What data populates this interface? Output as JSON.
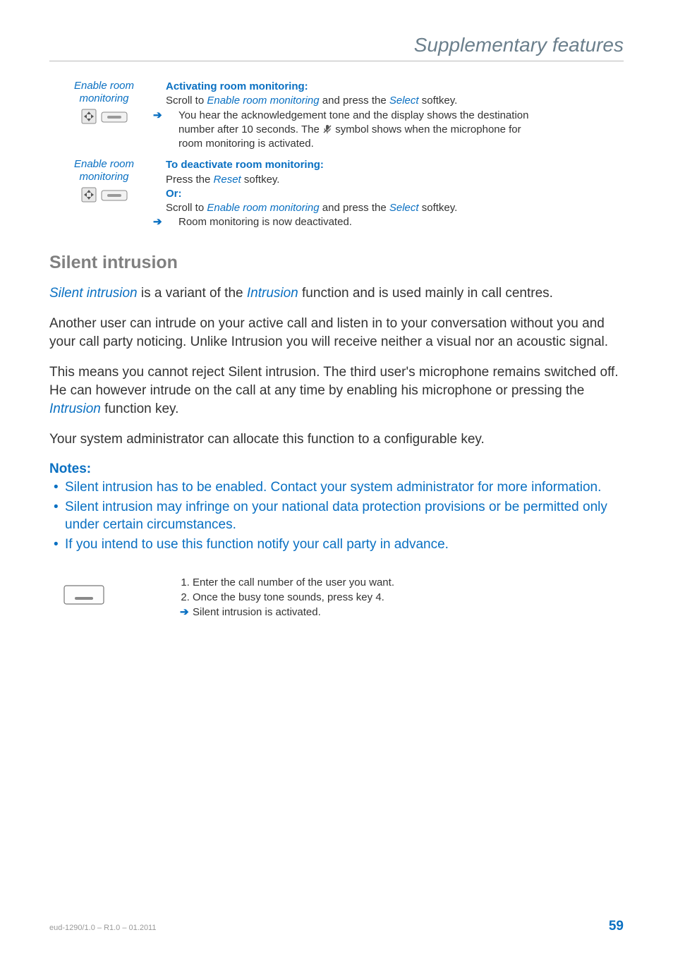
{
  "header": {
    "title": "Supplementary features"
  },
  "block1": {
    "left_label": "Enable room monitoring",
    "heading": "Activating room monitoring:",
    "line1_pre": "Scroll to ",
    "line1_term": "Enable room monitoring",
    "line1_mid": " and press the ",
    "line1_term2": "Select",
    "line1_post": " softkey.",
    "arrow_line_a": "You hear the acknowledgement tone and the display shows the destination",
    "arrow_line_b_pre": "number after 10 seconds. The ",
    "arrow_line_b_post": " symbol shows when the microphone for",
    "arrow_line_c": "room monitoring is activated."
  },
  "block2": {
    "left_label": "Enable room monitoring",
    "heading": "To deactivate room monitoring:",
    "line1_pre": "Press the ",
    "line1_term": "Reset",
    "line1_post": " softkey.",
    "or": "Or:",
    "line2_pre": "Scroll to ",
    "line2_term": "Enable room monitoring",
    "line2_mid": " and press the ",
    "line2_term2": "Select",
    "line2_post": " softkey.",
    "arrow_line": "Room monitoring is now deactivated."
  },
  "section": {
    "title": "Silent intrusion",
    "p1_term1": "Silent intrusion",
    "p1_mid": " is a variant of the ",
    "p1_term2": "Intrusion",
    "p1_post": " function and is used mainly in call centres.",
    "p2": "Another user can intrude on your active call and listen in to your conversation without you and your call party noticing. Unlike Intrusion you will receive neither a visual nor an acoustic signal.",
    "p3_pre": "This means you cannot reject Silent intrusion. The third user's microphone remains switched off. He can however intrude on the call at any time by enabling his microphone or pressing the ",
    "p3_term": "Intrusion",
    "p3_post": " function key.",
    "p4": "Your system administrator can allocate this function to a configurable key."
  },
  "notes": {
    "title": "Notes:",
    "items": [
      "Silent intrusion has to be enabled. Contact your system administrator for more information.",
      "Silent intrusion may infringe on your national data protection provisions or be permitted only under certain circumstances.",
      "If you intend to use this function notify your call party in advance."
    ]
  },
  "steps": {
    "s1": "Enter the call number of the user you want.",
    "s2": "Once the busy tone sounds, press key 4.",
    "arrow_line": "Silent intrusion is activated."
  },
  "footer": {
    "left": "eud-1290/1.0 – R1.0 – 01.2011",
    "right": "59"
  }
}
